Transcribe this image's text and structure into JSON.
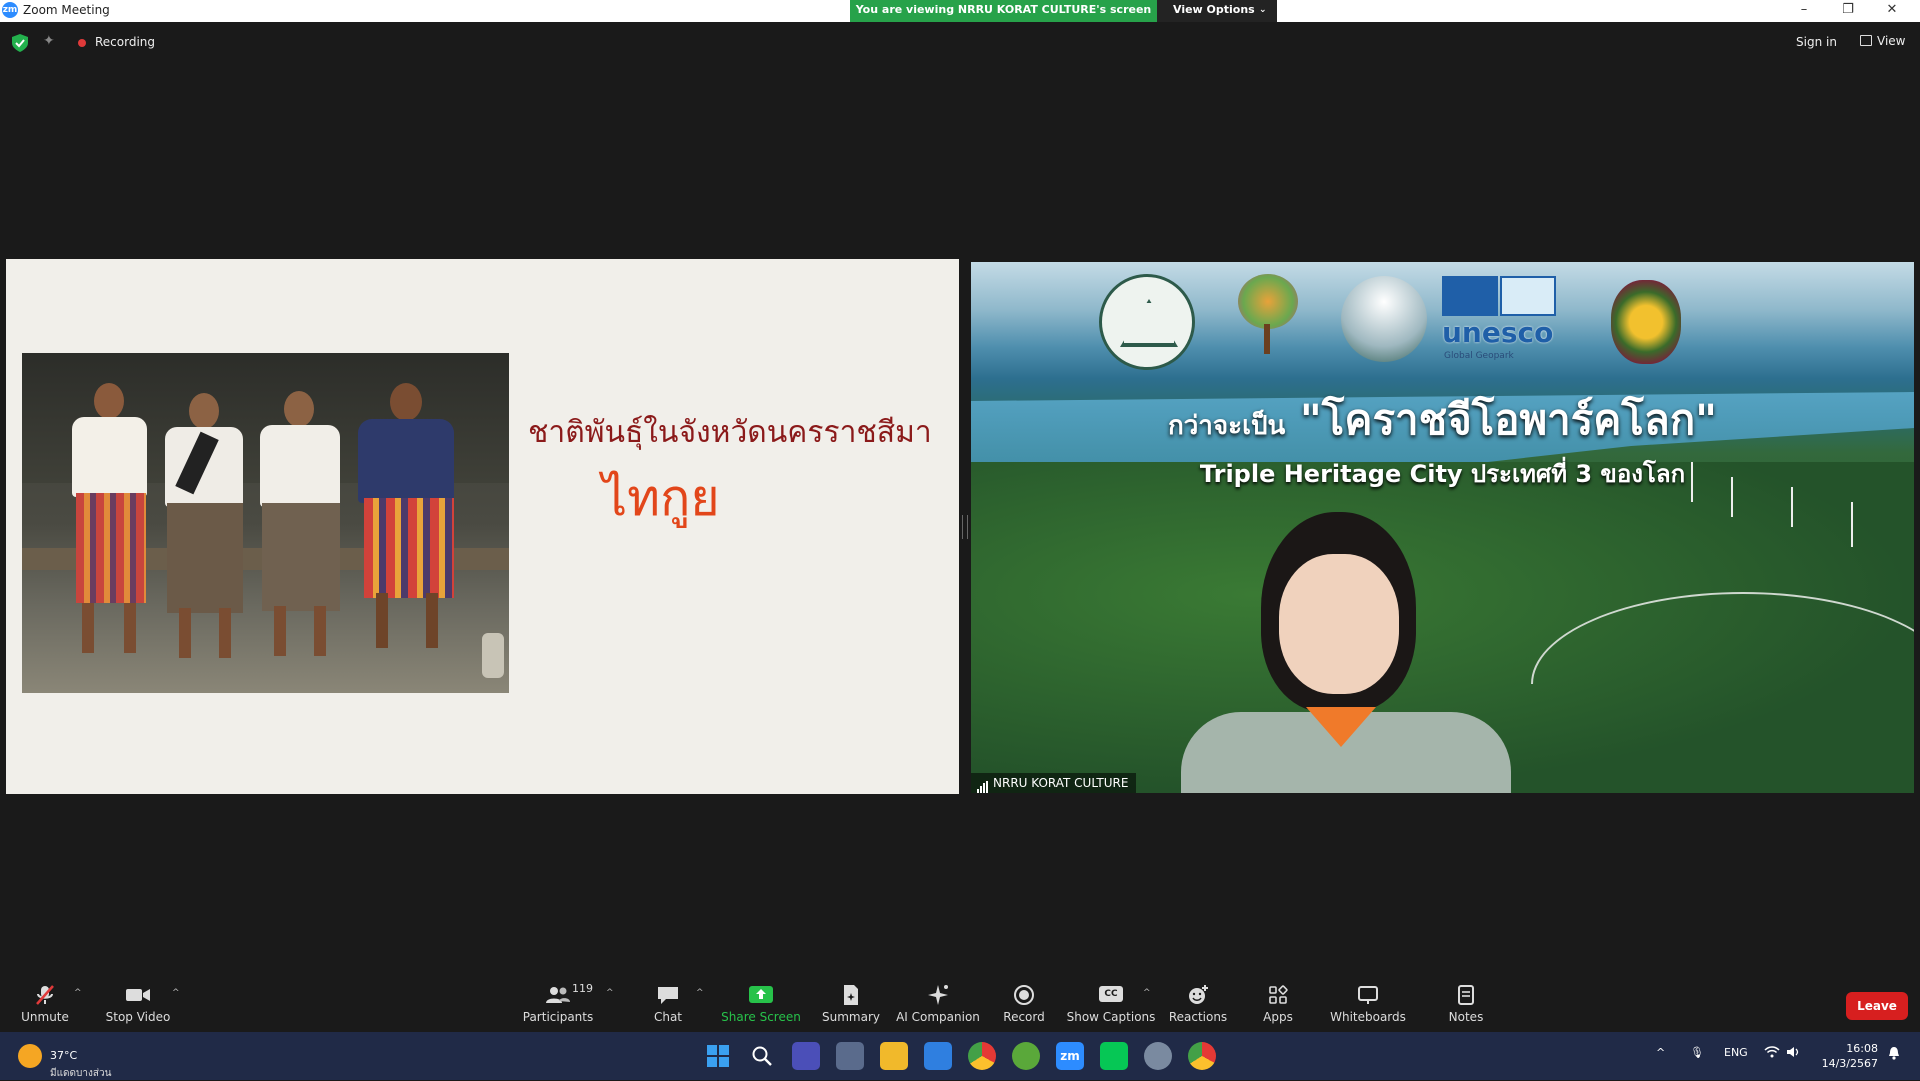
{
  "window": {
    "title": "Zoom Meeting",
    "app_icon_text": "zm",
    "minimize": "–",
    "restore": "❐",
    "close": "✕"
  },
  "share_banner": {
    "text": "You are viewing NRRU KORAT CULTURE's screen",
    "options_label": "View Options",
    "options_chevron": "⌄"
  },
  "topbar": {
    "recording_label": "Recording",
    "sign_in": "Sign in",
    "view_label": "View"
  },
  "shared_slide": {
    "title": "ชาติพันธุ์ในจังหวัดนครราชสีมา",
    "subtitle": "ไทกูย"
  },
  "video": {
    "headline_prefix": "กว่าจะเป็น",
    "headline_main": "\"โคราชจีโอพาร์คโลก\"",
    "sub_headline": "Triple Heritage City  ประเทศที่ 3 ของโลก",
    "unesco_text": "unesco",
    "unesco_sub": "Global Geopark",
    "participant_name": "NRRU KORAT CULTURE"
  },
  "toolbar": {
    "unmute": "Unmute",
    "stop_video": "Stop Video",
    "participants": "Participants",
    "participants_count": "119",
    "chat": "Chat",
    "share_screen": "Share Screen",
    "summary": "Summary",
    "ai_companion": "AI Companion",
    "record": "Record",
    "show_captions": "Show Captions",
    "captions_icon": "CC",
    "reactions": "Reactions",
    "apps": "Apps",
    "whiteboards": "Whiteboards",
    "notes": "Notes",
    "leave": "Leave",
    "share_color": "#27c24a",
    "leave_color": "#d71f1f"
  },
  "taskbar": {
    "temperature": "37°C",
    "condition": "มีแดดบางส่วน",
    "language": "ENG",
    "time": "16:08",
    "date": "14/3/2567",
    "zoom_icon": "zm"
  }
}
